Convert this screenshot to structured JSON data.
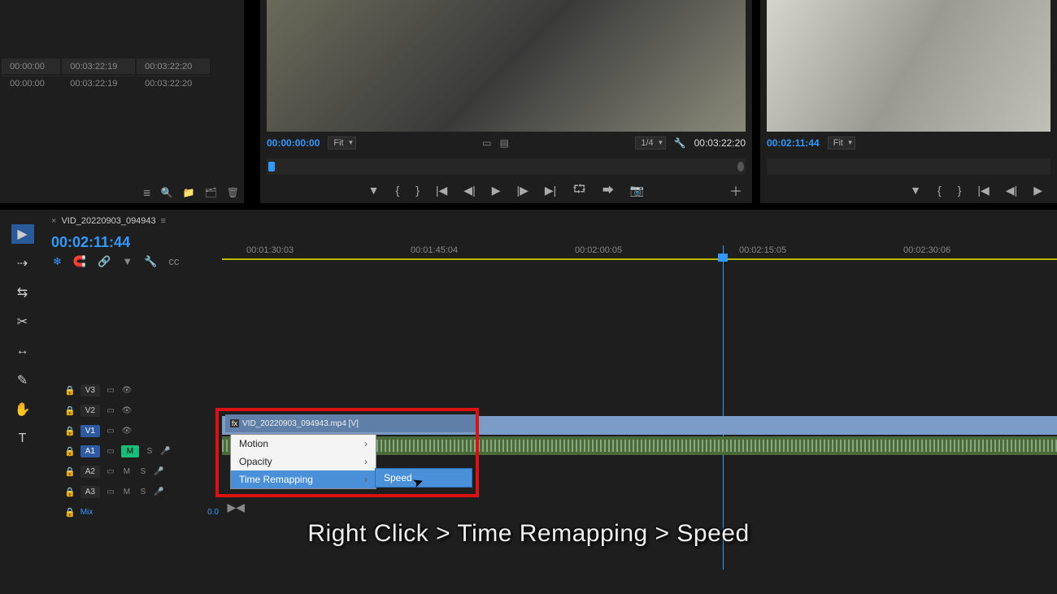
{
  "metadata": {
    "rows": [
      [
        "00:00:00",
        "00:03:22:19",
        "00:03:22:20"
      ],
      [
        "00:00:00",
        "00:03:22:19",
        "00:03:22:20"
      ]
    ]
  },
  "source_monitor": {
    "tc_in": "00:00:00:00",
    "fit": "Fit",
    "scale": "1/4",
    "tc_out": "00:03:22:20"
  },
  "program_monitor": {
    "tc": "00:02:11:44",
    "fit": "Fit"
  },
  "timeline": {
    "sequence_name": "VID_20220903_094943",
    "playhead_tc": "00:02:11:44",
    "ticks": [
      "00:01:30:03",
      "00:01:45:04",
      "00:02:00:05",
      "00:02:15:05",
      "00:02:30:06"
    ],
    "tracks": {
      "v3": "V3",
      "v2": "V2",
      "v1": "V1",
      "a1": "A1",
      "a2": "A2",
      "a3": "A3",
      "mix": "Mix",
      "mix_val": "0.0",
      "m": "M",
      "s": "S"
    },
    "clip_label": "VID_20220903_094943.mp4 [V]"
  },
  "context_menu": {
    "items": [
      "Motion",
      "Opacity",
      "Time Remapping"
    ],
    "submenu": "Speed"
  },
  "caption": "Right Click > Time Remapping > Speed"
}
